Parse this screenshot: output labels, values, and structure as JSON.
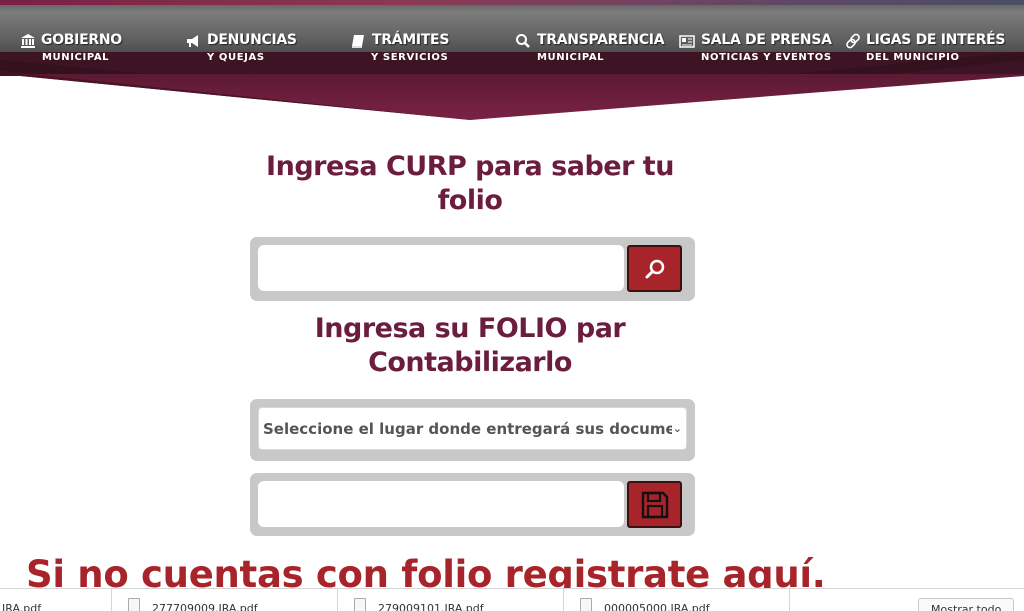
{
  "nav": {
    "items": [
      {
        "title": "GOBIERNO",
        "sub": "MUNICIPAL",
        "icon": "bank-icon"
      },
      {
        "title": "DENUNCIAS",
        "sub": "Y QUEJAS",
        "icon": "megaphone-icon"
      },
      {
        "title": "TRÁMITES",
        "sub": "Y SERVICIOS",
        "icon": "book-icon"
      },
      {
        "title": "TRANSPARENCIA",
        "sub": "MUNICIPAL",
        "icon": "search-icon"
      },
      {
        "title": "SALA DE PRENSA",
        "sub": "NOTICIAS Y EVENTOS",
        "icon": "newspaper-icon"
      },
      {
        "title": "LIGAS DE INTERÉS",
        "sub": "DEL MUNICIPIO",
        "icon": "link-icon"
      }
    ]
  },
  "main": {
    "curp_heading": "Ingresa CURP para saber tu folio",
    "curp_input": {
      "value": "",
      "placeholder": ""
    },
    "search_button_icon": "search-icon",
    "folio_heading": "Ingresa su FOLIO par Contabilizarlo",
    "location_select": {
      "selected": "Seleccione el lugar donde entregará sus documentos"
    },
    "folio_input": {
      "value": "",
      "placeholder": ""
    },
    "save_button_icon": "floppy-disk-icon",
    "register_heading": "Si no cuentas con folio registrate aquí."
  },
  "downloads": {
    "items": [
      "IRA.pdf",
      "277709009.IRA.pdf",
      "279009101.IRA.pdf",
      "000005000.IRA.pdf"
    ],
    "show_all": "Mostrar todo"
  },
  "colors": {
    "brand_maroon": "#6b1d3d",
    "accent_red": "#a8242b",
    "nav_dark": "#3d1423"
  }
}
